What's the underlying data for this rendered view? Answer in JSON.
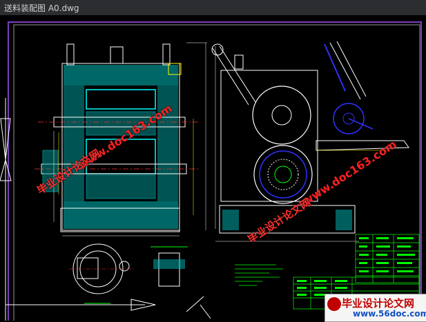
{
  "window": {
    "title": "送料装配图   A0.dwg"
  },
  "watermarks": {
    "url_text": "www.doc163.com",
    "site_name": "毕业设计论文网",
    "color": "#ff2020"
  },
  "badge": {
    "site_name": "毕业设计论文网",
    "url": "www.56doc.com"
  },
  "drawing": {
    "background": "#000000",
    "border_color": "#7b3fbf",
    "line_colors": [
      "#00ffff",
      "#ffffff",
      "#00ff00",
      "#ffff00",
      "#3030ff",
      "#ff3030"
    ]
  }
}
